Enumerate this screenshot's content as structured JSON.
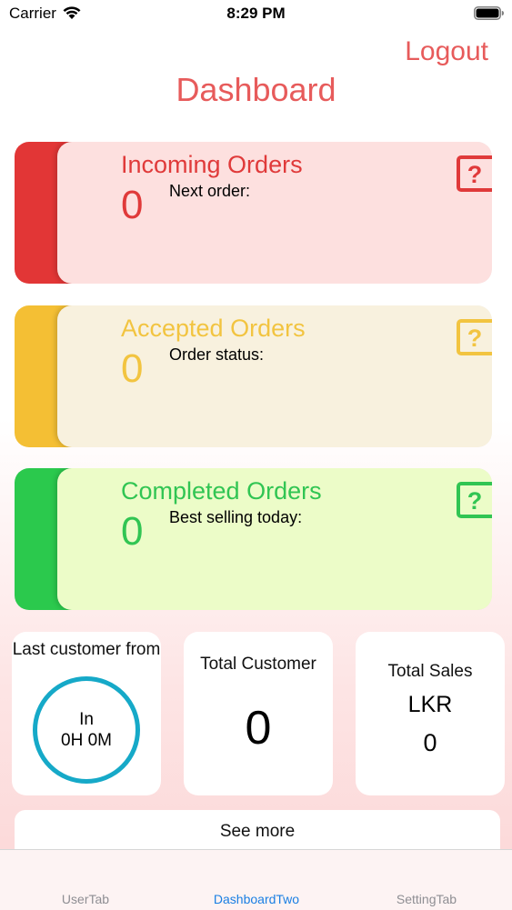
{
  "status_bar": {
    "carrier": "Carrier",
    "time": "8:29 PM",
    "wifi_icon": "wifi-icon",
    "battery_icon": "battery-full-icon"
  },
  "header": {
    "logout_label": "Logout",
    "title": "Dashboard"
  },
  "orders": {
    "incoming": {
      "title": "Incoming Orders",
      "count": "0",
      "subtitle": "Next order:",
      "icon": "help-icon",
      "accent_color": "#e23636"
    },
    "accepted": {
      "title": "Accepted Orders",
      "count": "0",
      "subtitle": "Order status:",
      "icon": "help-icon",
      "accent_color": "#f4bf34"
    },
    "completed": {
      "title": "Completed Orders",
      "count": "0",
      "subtitle": "Best selling today:",
      "icon": "help-icon",
      "accent_color": "#2bc94d"
    }
  },
  "stats": {
    "last_customer": {
      "label": "Last customer from",
      "line1": "In",
      "line2": "0H 0M"
    },
    "total_customer": {
      "label": "Total Customer",
      "value": "0"
    },
    "total_sales": {
      "label": "Total Sales",
      "currency": "LKR",
      "value": "0"
    }
  },
  "see_more_label": "See more",
  "tabs": [
    {
      "label": "UserTab",
      "active": false
    },
    {
      "label": "DashboardTwo",
      "active": true
    },
    {
      "label": "SettingTab",
      "active": false
    }
  ],
  "colors": {
    "brand": "#e75b5b",
    "active_tab": "#1a7fe3",
    "timer_ring": "#16a9c8"
  }
}
